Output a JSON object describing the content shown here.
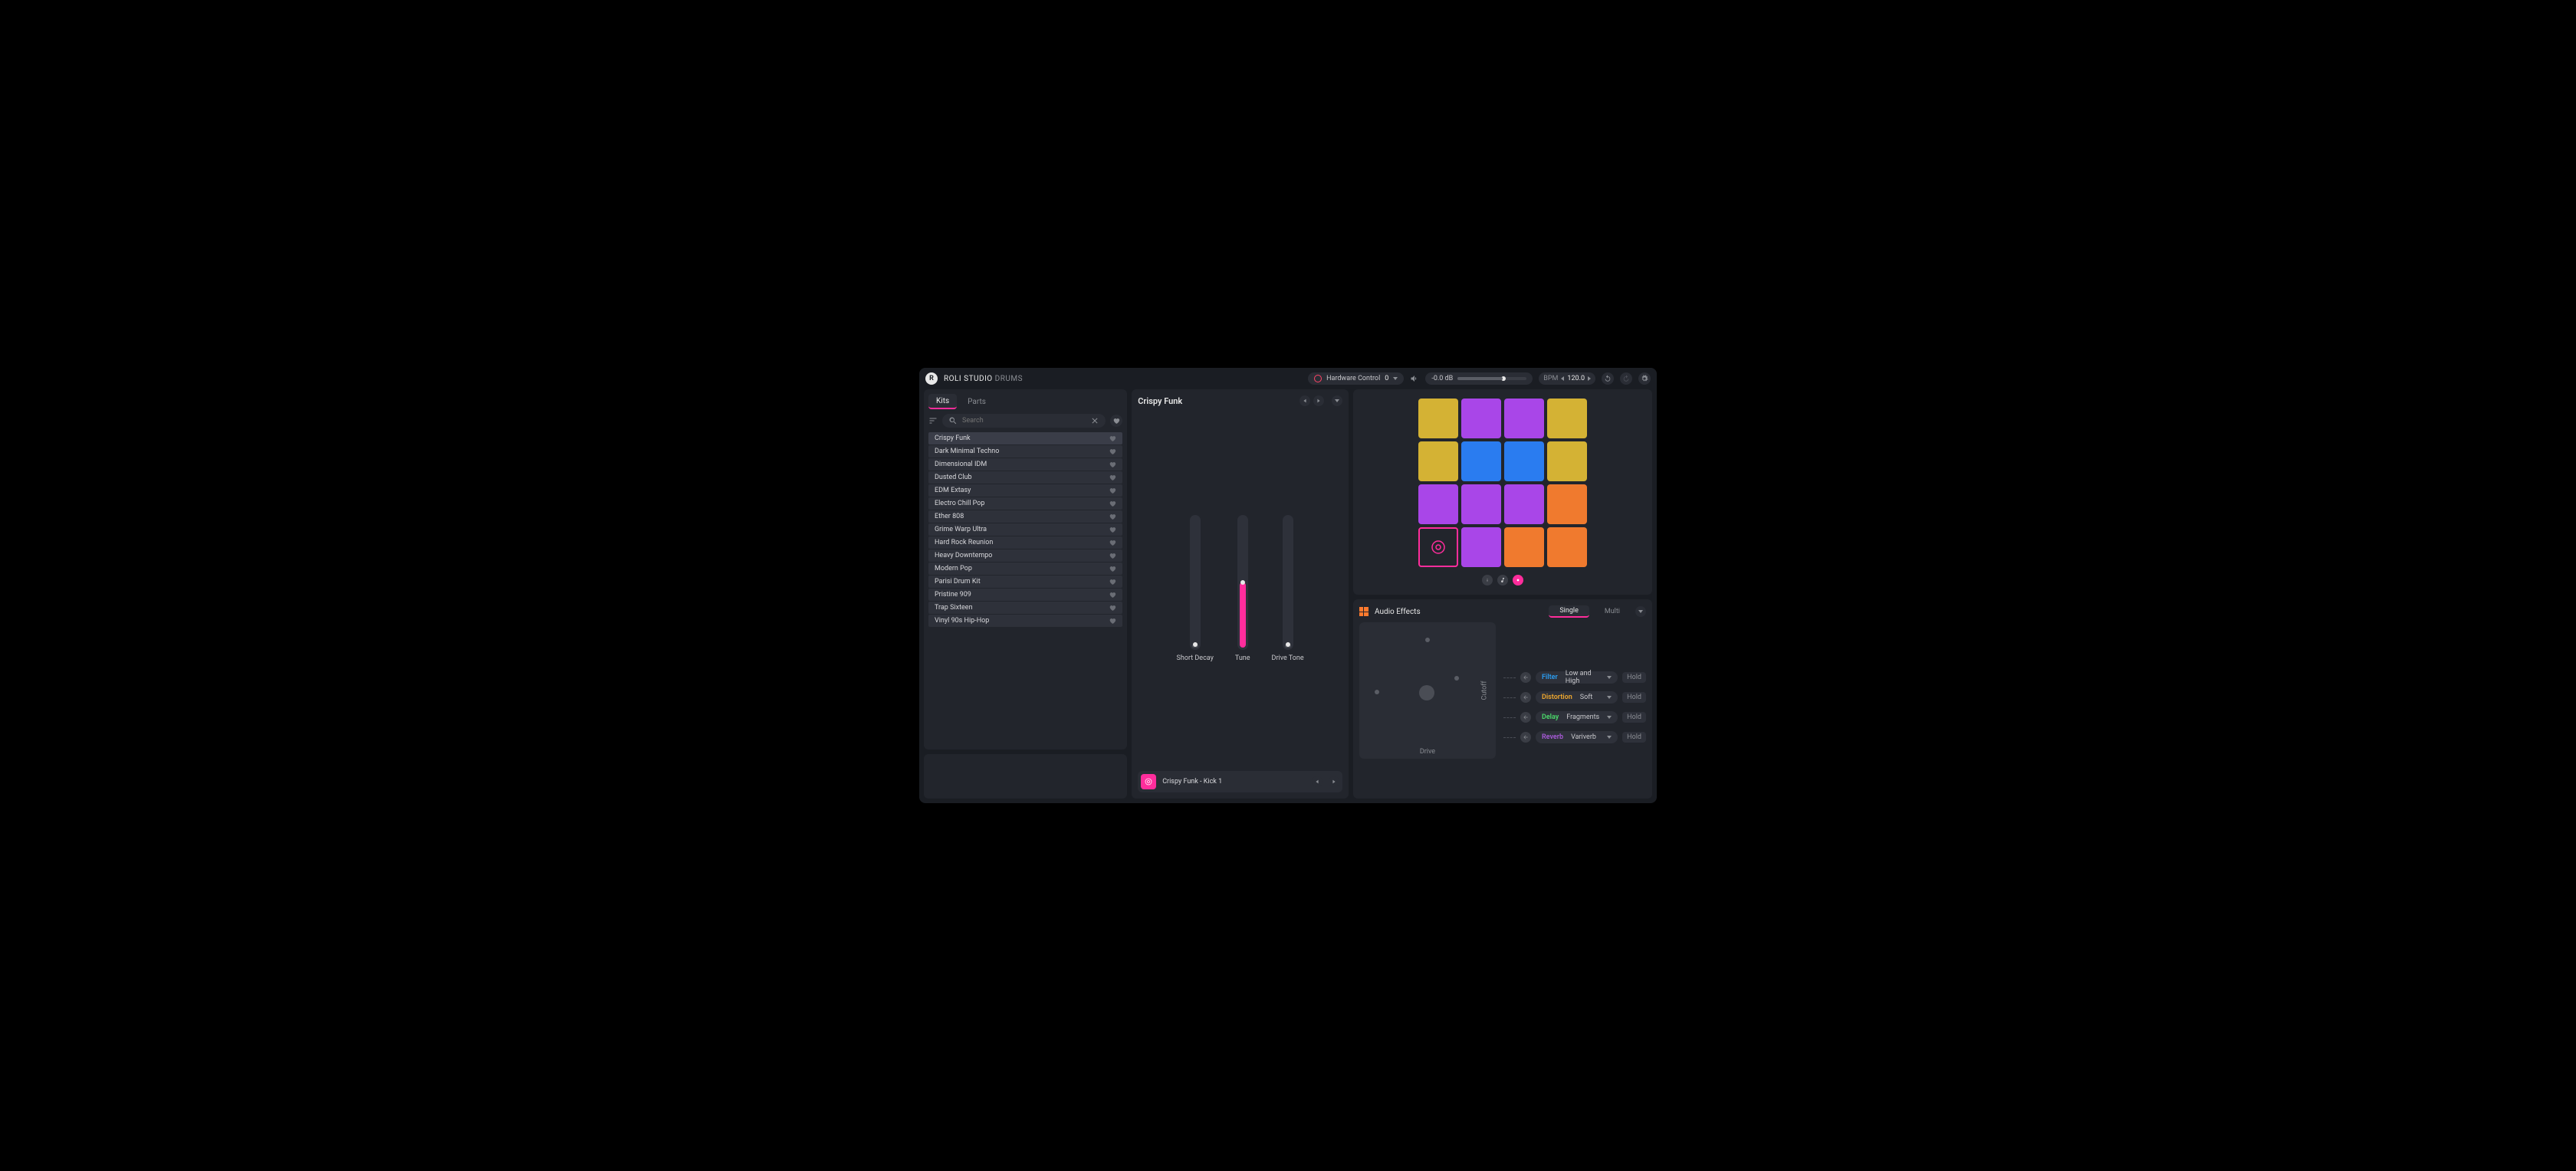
{
  "app": {
    "title_main": "ROLI STUDIO",
    "title_sub": "DRUMS"
  },
  "topbar": {
    "hardware_label": "Hardware Control",
    "hardware_value": "0",
    "db_value": "-0.0 dB",
    "bpm_label": "BPM",
    "bpm_value": "120.0"
  },
  "browser": {
    "tabs": {
      "kits": "Kits",
      "parts": "Parts"
    },
    "search_placeholder": "Search",
    "kits": [
      "Crispy Funk",
      "Dark Minimal Techno",
      "Dimensional IDM",
      "Dusted Club",
      "EDM Extasy",
      "Electro Chill Pop",
      "Ether 808",
      "Grime Warp Ultra",
      "Hard Rock Reunion",
      "Heavy Downtempo",
      "Modern Pop",
      "Parisi Drum Kit",
      "Pristine 909",
      "Trap Sixteen",
      "Vinyl 90s Hip-Hop"
    ],
    "selected_index": 0
  },
  "macro": {
    "kit_name": "Crispy Funk",
    "sliders": [
      {
        "label": "Short Decay",
        "value": 0.02
      },
      {
        "label": "Tune",
        "value": 0.5
      },
      {
        "label": "Drive Tone",
        "value": 0.02
      }
    ],
    "sample_name": "Crispy Funk - Kick 1"
  },
  "pads": {
    "colors": [
      "yellow",
      "purple",
      "purple",
      "yellow",
      "yellow",
      "blue",
      "blue",
      "yellow",
      "purple",
      "purple",
      "purple",
      "orange",
      "selected",
      "purple",
      "orange",
      "orange"
    ]
  },
  "fx": {
    "title": "Audio Effects",
    "tabs": {
      "single": "Single",
      "multi": "Multi"
    },
    "xy": {
      "x_label": "Drive",
      "y_label": "Cutoff"
    },
    "rows": [
      {
        "type": "Filter",
        "cls": "filter",
        "preset": "Low and High",
        "hold": "Hold"
      },
      {
        "type": "Distortion",
        "cls": "dist",
        "preset": "Soft",
        "hold": "Hold"
      },
      {
        "type": "Delay",
        "cls": "delay",
        "preset": "Fragments",
        "hold": "Hold"
      },
      {
        "type": "Reverb",
        "cls": "reverb",
        "preset": "Variverb",
        "hold": "Hold"
      }
    ]
  }
}
